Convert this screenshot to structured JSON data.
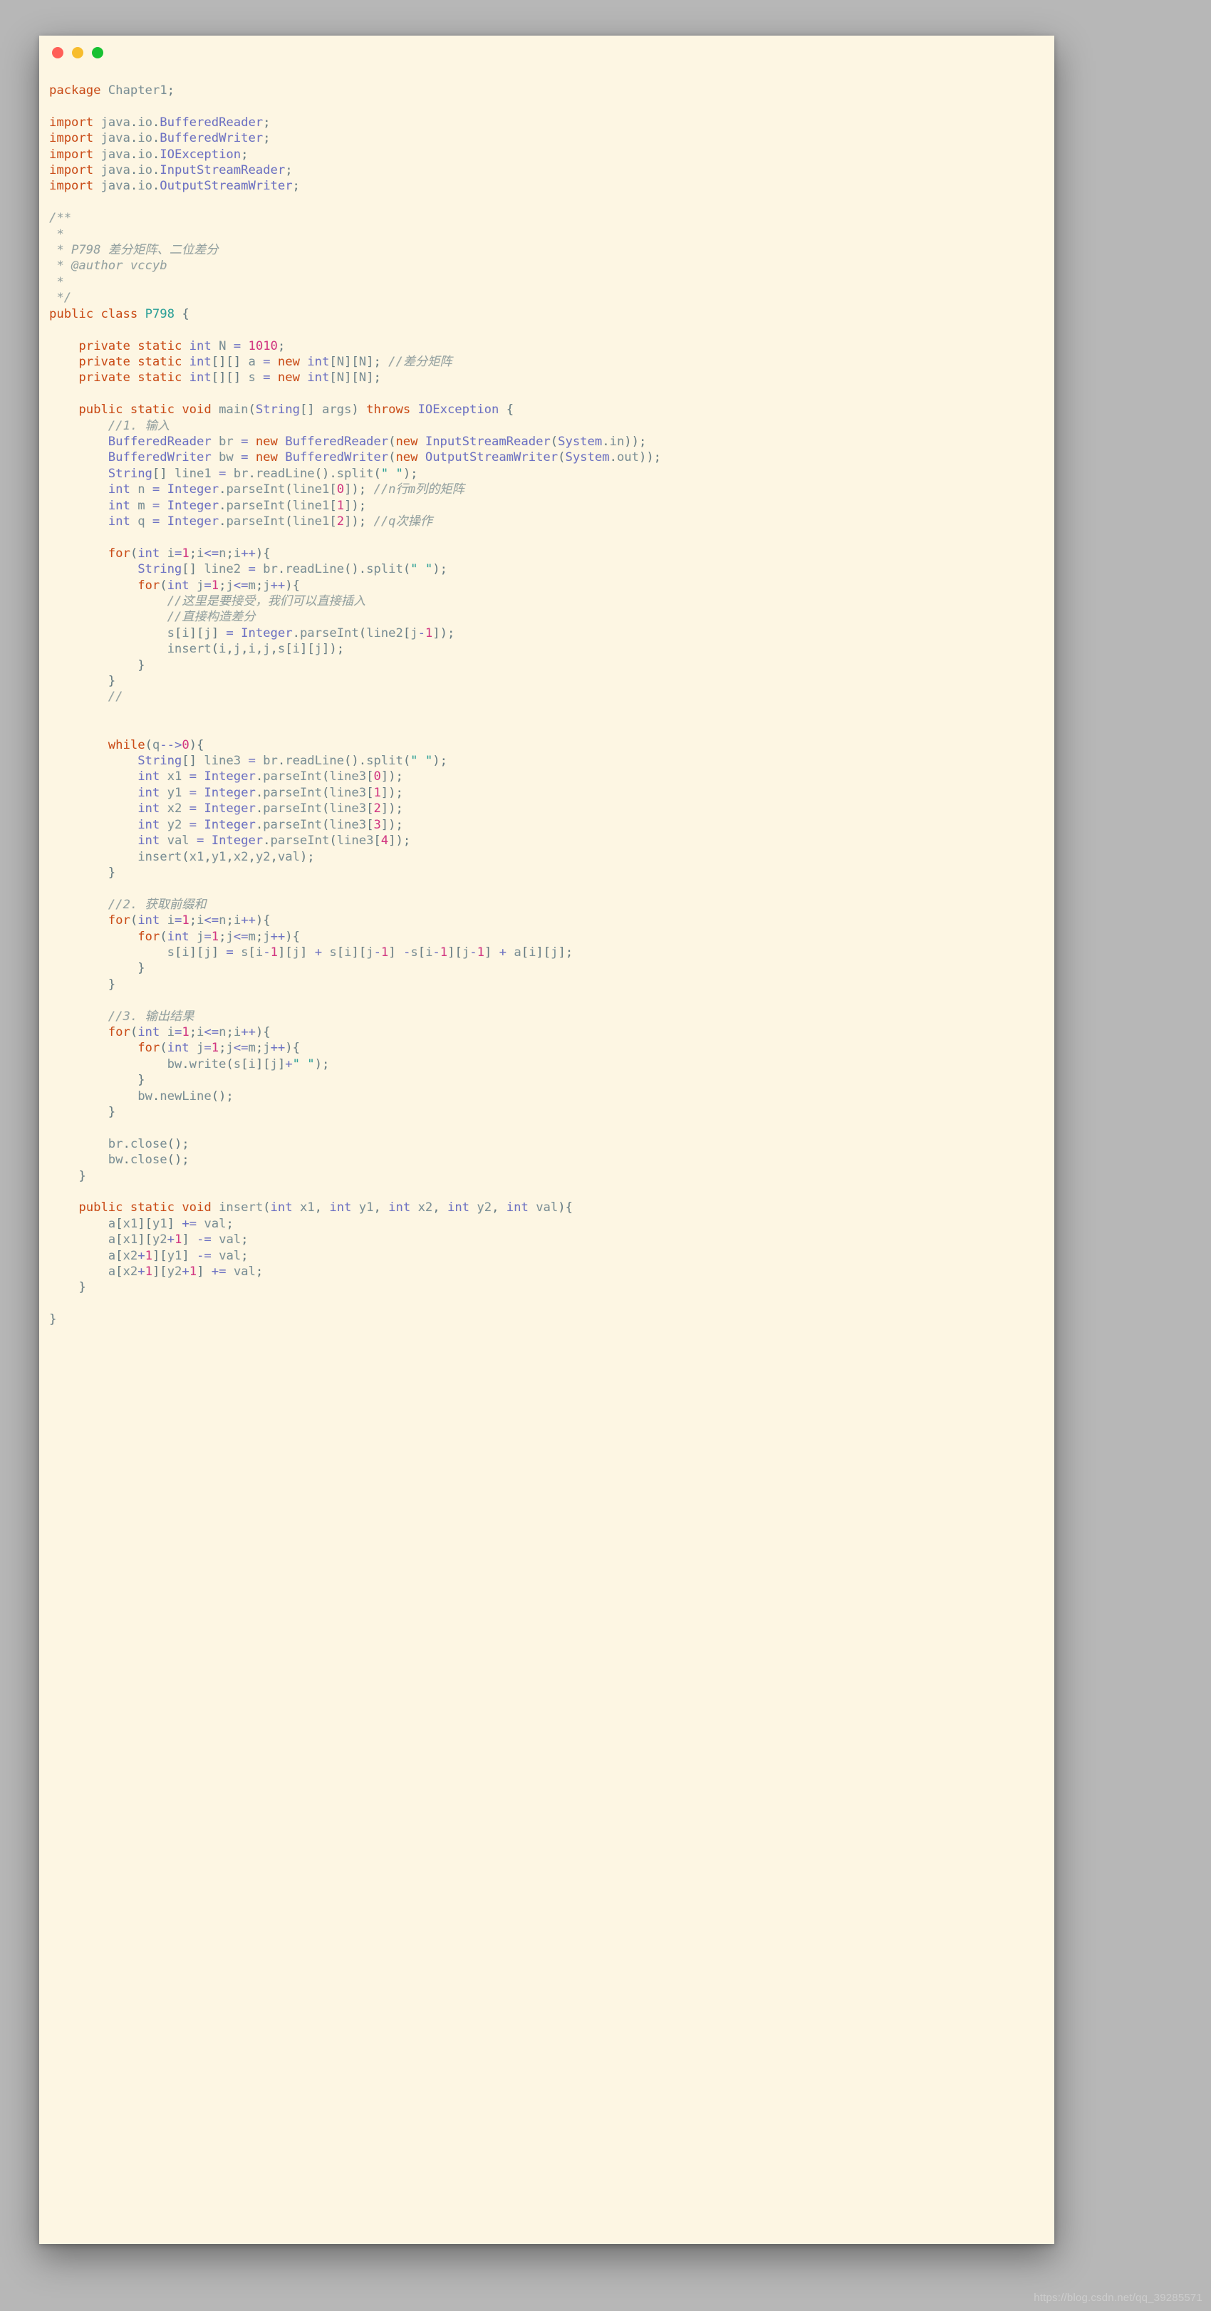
{
  "window": {
    "background_hex": "#fdf6e3",
    "page_background_hex": "#b7b7b7",
    "traffic_lights": [
      {
        "name": "close",
        "color": "#ff5f58"
      },
      {
        "name": "minimize",
        "color": "#f7bd2e"
      },
      {
        "name": "maximize",
        "color": "#18c132"
      }
    ]
  },
  "theme": {
    "keyword_hex": "#cb4b16",
    "type_hex": "#6c71c4",
    "class_hex": "#2aa198",
    "identifier_hex": "#7a8f96",
    "number_hex": "#d33682",
    "string_hex": "#2aa198",
    "comment_hex": "#93a1a1",
    "text_hex": "#657b83"
  },
  "watermark": {
    "text": "https://blog.csdn.net/qq_39285571"
  },
  "code": {
    "language": "java",
    "lines": [
      "package Chapter1;",
      "",
      "import java.io.BufferedReader;",
      "import java.io.BufferedWriter;",
      "import java.io.IOException;",
      "import java.io.InputStreamReader;",
      "import java.io.OutputStreamWriter;",
      "",
      "/**",
      " *",
      " * P798 差分矩阵、二位差分",
      " * @author vccyb",
      " *",
      " */",
      "public class P798 {",
      "",
      "    private static int N = 1010;",
      "    private static int[][] a = new int[N][N]; //差分矩阵",
      "    private static int[][] s = new int[N][N];",
      "",
      "    public static void main(String[] args) throws IOException {",
      "        //1. 输入",
      "        BufferedReader br = new BufferedReader(new InputStreamReader(System.in));",
      "        BufferedWriter bw = new BufferedWriter(new OutputStreamWriter(System.out));",
      "        String[] line1 = br.readLine().split(\" \");",
      "        int n = Integer.parseInt(line1[0]); //n行m列的矩阵",
      "        int m = Integer.parseInt(line1[1]);",
      "        int q = Integer.parseInt(line1[2]); //q次操作",
      "",
      "        for(int i=1;i<=n;i++){",
      "            String[] line2 = br.readLine().split(\" \");",
      "            for(int j=1;j<=m;j++){",
      "                //这里是要接受，我们可以直接插入",
      "                //直接构造差分",
      "                s[i][j] = Integer.parseInt(line2[j-1]);",
      "                insert(i,j,i,j,s[i][j]);",
      "            }",
      "        }",
      "        //",
      "",
      "",
      "        while(q-->0){",
      "            String[] line3 = br.readLine().split(\" \");",
      "            int x1 = Integer.parseInt(line3[0]);",
      "            int y1 = Integer.parseInt(line3[1]);",
      "            int x2 = Integer.parseInt(line3[2]);",
      "            int y2 = Integer.parseInt(line3[3]);",
      "            int val = Integer.parseInt(line3[4]);",
      "            insert(x1,y1,x2,y2,val);",
      "        }",
      "",
      "        //2. 获取前缀和",
      "        for(int i=1;i<=n;i++){",
      "            for(int j=1;j<=m;j++){",
      "                s[i][j] = s[i-1][j] + s[i][j-1] -s[i-1][j-1] + a[i][j];",
      "            }",
      "        }",
      "",
      "        //3. 输出结果",
      "        for(int i=1;i<=n;i++){",
      "            for(int j=1;j<=m;j++){",
      "                bw.write(s[i][j]+\" \");",
      "            }",
      "            bw.newLine();",
      "        }",
      "",
      "        br.close();",
      "        bw.close();",
      "    }",
      "",
      "    public static void insert(int x1, int y1, int x2, int y2, int val){",
      "        a[x1][y1] += val;",
      "        a[x1][y2+1] -= val;",
      "        a[x2+1][y1] -= val;",
      "        a[x2+1][y2+1] += val;",
      "    }",
      "",
      "}"
    ]
  }
}
